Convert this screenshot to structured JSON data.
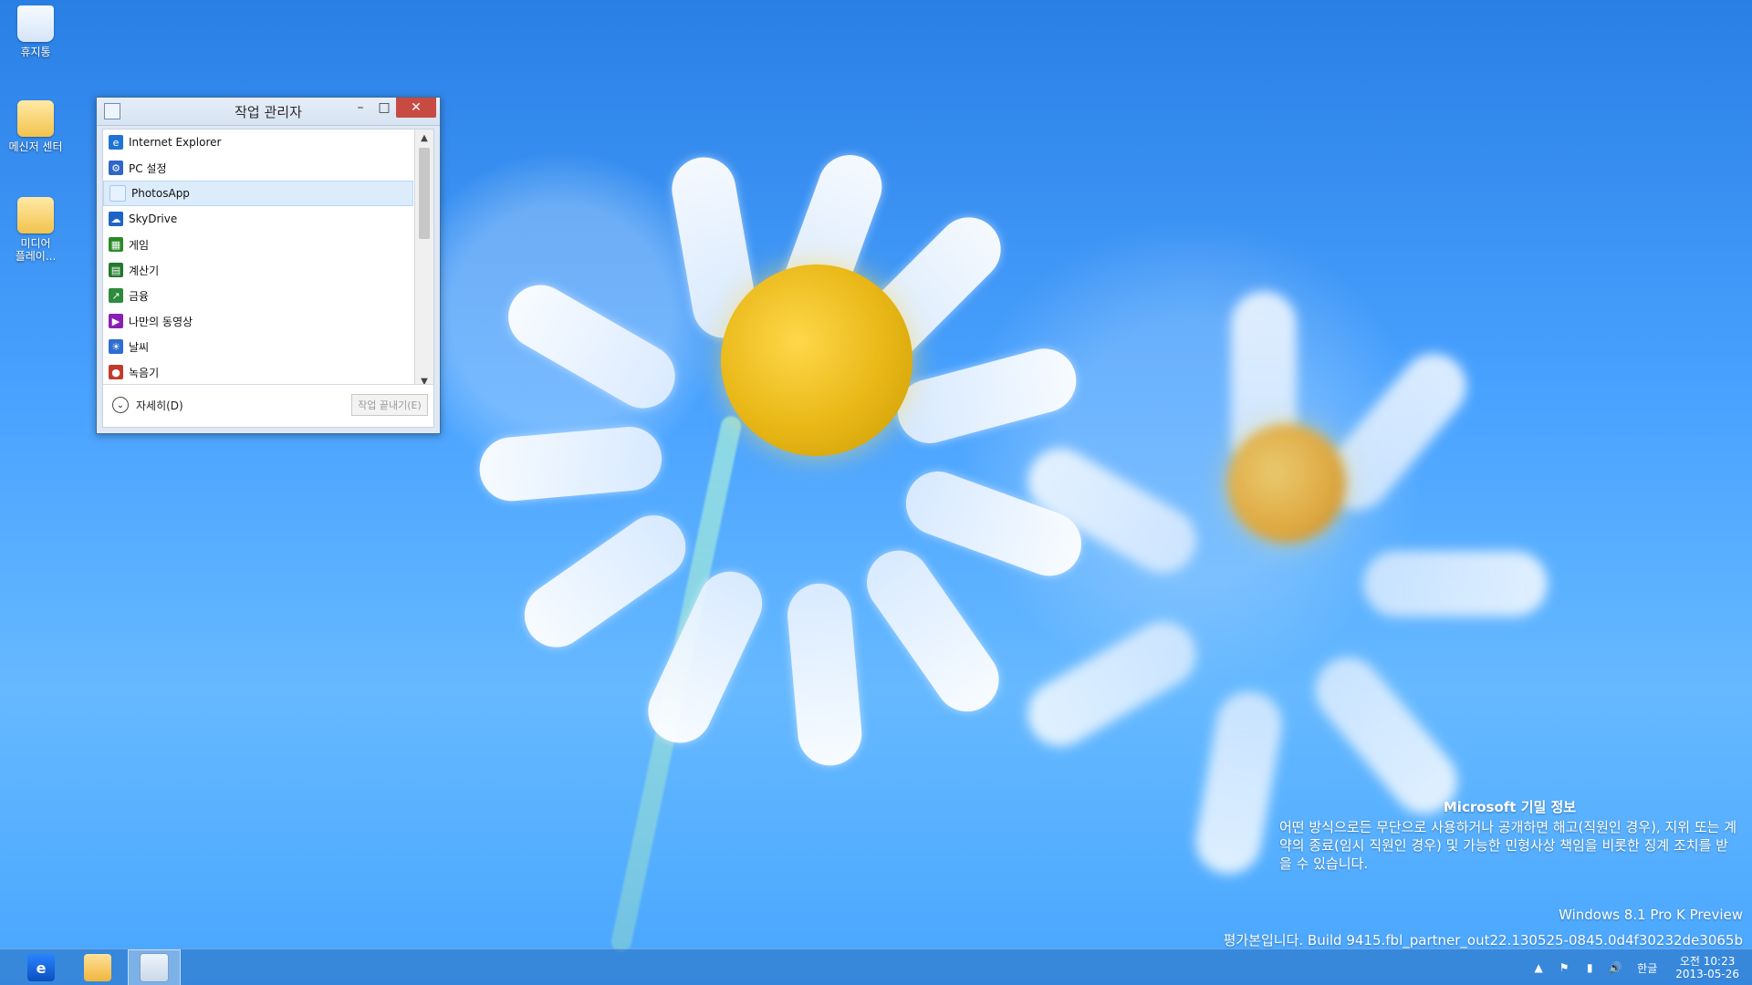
{
  "desktop": {
    "icons": [
      {
        "label": "휴지통"
      },
      {
        "label": "메신저 센터"
      },
      {
        "label": "미디어\n플레이..."
      }
    ]
  },
  "taskManager": {
    "title": "작업 관리자",
    "apps": [
      {
        "name": "Internet Explorer",
        "icon": "ie-icon"
      },
      {
        "name": "PC 설정",
        "icon": "gear-icon"
      },
      {
        "name": "PhotosApp",
        "icon": "photos-icon"
      },
      {
        "name": "SkyDrive",
        "icon": "cloud-icon"
      },
      {
        "name": "게임",
        "icon": "games-icon"
      },
      {
        "name": "계산기",
        "icon": "calculator-icon"
      },
      {
        "name": "금융",
        "icon": "finance-icon"
      },
      {
        "name": "나만의 동영상",
        "icon": "video-icon"
      },
      {
        "name": "날씨",
        "icon": "weather-icon"
      },
      {
        "name": "녹음기",
        "icon": "recorder-icon"
      }
    ],
    "selectedIndex": 2,
    "detailsLabel": "자세히(D)",
    "endTaskLabel": "작업 끝내기(E)",
    "controls": {
      "minimize": "–",
      "maximize": "□",
      "close": "✕"
    }
  },
  "watermark": {
    "title": "Microsoft 기밀 정보",
    "body": "어떤 방식으로든 무단으로 사용하거나 공개하면 해고(직원인 경우), 지위 또는 계약의 종료(임시 직원인 경우) 및 가능한 민형사상 책임을 비롯한 징계 조치를 받을 수 있습니다.",
    "edition": "Windows 8.1 Pro K Preview",
    "build": "평가본입니다. Build 9415.fbl_partner_out22.130525-0845.0d4f30232de3065b"
  },
  "taskbar": {
    "buttons": [
      {
        "name": "internet-explorer",
        "active": false
      },
      {
        "name": "file-explorer",
        "active": false
      },
      {
        "name": "task-manager",
        "active": true
      }
    ],
    "tray": {
      "lang": "한글",
      "time": "오전 10:23",
      "date": "2013-05-26"
    }
  },
  "colors": {
    "closeRed": "#c74b42",
    "selection": "#dcecfb"
  }
}
